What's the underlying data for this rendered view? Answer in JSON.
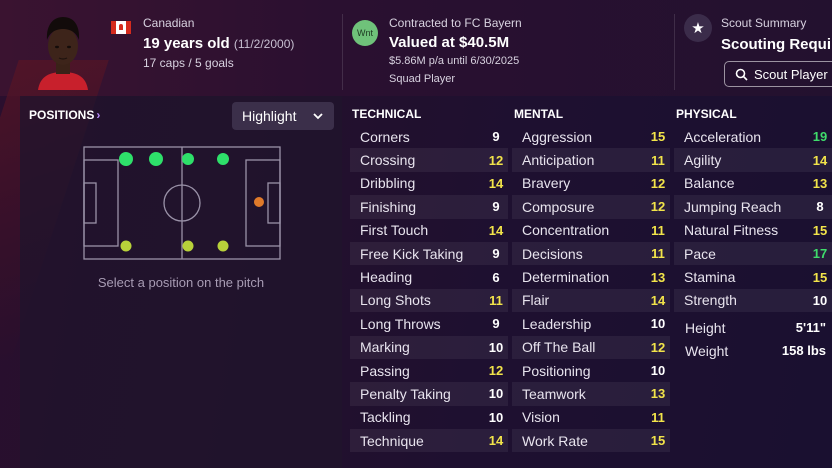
{
  "player": {
    "nationality": "Canadian",
    "age": "19 years old",
    "dob": "(11/2/2000)",
    "caps_goals": "17 caps / 5 goals"
  },
  "contract": {
    "badge": "Wnt",
    "label": "Contracted to FC Bayern",
    "value": "Valued at $40.5M",
    "wage": "$5.86M p/a until 6/30/2025",
    "status": "Squad Player"
  },
  "scout": {
    "label": "Scout Summary",
    "title": "Scouting Requi",
    "button": "Scout Player"
  },
  "positions": {
    "title": "POSITIONS",
    "highlight": "Highlight",
    "hint": "Select a position on the pitch",
    "colors": {
      "natural": "#2ee06a",
      "accomplished": "#b8d13a",
      "unconvincing": "#e07a2a",
      "lines": "#9a92a8"
    }
  },
  "technical": {
    "title": "TECHNICAL",
    "rows": [
      {
        "name": "Corners",
        "value": "9",
        "tier": "white"
      },
      {
        "name": "Crossing",
        "value": "12",
        "tier": "yellow"
      },
      {
        "name": "Dribbling",
        "value": "14",
        "tier": "yellow"
      },
      {
        "name": "Finishing",
        "value": "9",
        "tier": "white"
      },
      {
        "name": "First Touch",
        "value": "14",
        "tier": "yellow"
      },
      {
        "name": "Free Kick Taking",
        "value": "9",
        "tier": "white"
      },
      {
        "name": "Heading",
        "value": "6",
        "tier": "white"
      },
      {
        "name": "Long Shots",
        "value": "11",
        "tier": "yellow"
      },
      {
        "name": "Long Throws",
        "value": "9",
        "tier": "white"
      },
      {
        "name": "Marking",
        "value": "10",
        "tier": "white"
      },
      {
        "name": "Passing",
        "value": "12",
        "tier": "yellow"
      },
      {
        "name": "Penalty Taking",
        "value": "10",
        "tier": "white"
      },
      {
        "name": "Tackling",
        "value": "10",
        "tier": "white"
      },
      {
        "name": "Technique",
        "value": "14",
        "tier": "yellow"
      }
    ]
  },
  "mental": {
    "title": "MENTAL",
    "rows": [
      {
        "name": "Aggression",
        "value": "15",
        "tier": "yellow"
      },
      {
        "name": "Anticipation",
        "value": "11",
        "tier": "yellow"
      },
      {
        "name": "Bravery",
        "value": "12",
        "tier": "yellow"
      },
      {
        "name": "Composure",
        "value": "12",
        "tier": "yellow"
      },
      {
        "name": "Concentration",
        "value": "11",
        "tier": "yellow"
      },
      {
        "name": "Decisions",
        "value": "11",
        "tier": "yellow"
      },
      {
        "name": "Determination",
        "value": "13",
        "tier": "yellow"
      },
      {
        "name": "Flair",
        "value": "14",
        "tier": "yellow"
      },
      {
        "name": "Leadership",
        "value": "10",
        "tier": "white"
      },
      {
        "name": "Off The Ball",
        "value": "12",
        "tier": "yellow"
      },
      {
        "name": "Positioning",
        "value": "10",
        "tier": "white"
      },
      {
        "name": "Teamwork",
        "value": "13",
        "tier": "yellow"
      },
      {
        "name": "Vision",
        "value": "11",
        "tier": "yellow"
      },
      {
        "name": "Work Rate",
        "value": "15",
        "tier": "yellow"
      }
    ]
  },
  "physical": {
    "title": "PHYSICAL",
    "rows": [
      {
        "name": "Acceleration",
        "value": "19",
        "tier": "green"
      },
      {
        "name": "Agility",
        "value": "14",
        "tier": "yellow"
      },
      {
        "name": "Balance",
        "value": "13",
        "tier": "yellow"
      },
      {
        "name": "Jumping Reach",
        "value": "8",
        "tier": "white"
      },
      {
        "name": "Natural Fitness",
        "value": "15",
        "tier": "yellow"
      },
      {
        "name": "Pace",
        "value": "17",
        "tier": "green"
      },
      {
        "name": "Stamina",
        "value": "15",
        "tier": "yellow"
      },
      {
        "name": "Strength",
        "value": "10",
        "tier": "white"
      }
    ],
    "height_label": "Height",
    "height": "5'11\"",
    "weight_label": "Weight",
    "weight": "158 lbs"
  }
}
